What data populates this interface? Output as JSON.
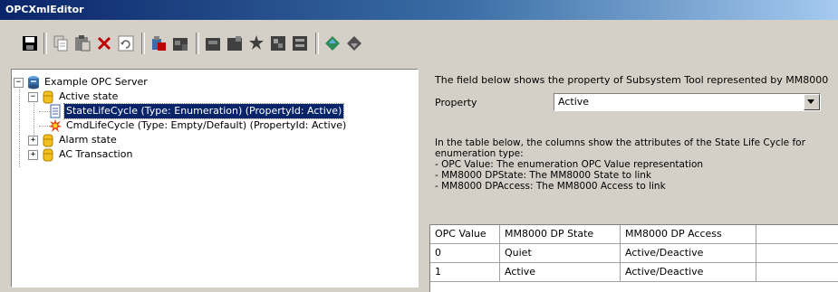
{
  "window": {
    "title": "OPCXmlEditor"
  },
  "toolbar": {
    "buttons": [
      {
        "icon": "save-icon"
      },
      {
        "icon": "copy-icon"
      },
      {
        "icon": "paste-icon"
      },
      {
        "icon": "delete-icon"
      },
      {
        "icon": "undo-icon"
      },
      {
        "icon": "add-server-icon"
      },
      {
        "icon": "add-folder-icon"
      },
      {
        "icon": "add-item-icon"
      },
      {
        "icon": "add-property-icon"
      },
      {
        "icon": "add-star-icon"
      },
      {
        "icon": "add-enum-icon"
      },
      {
        "icon": "add-list-icon"
      },
      {
        "icon": "move-up-icon"
      },
      {
        "icon": "move-down-icon"
      }
    ]
  },
  "tree": {
    "root": "Example OPC Server",
    "active_state": "Active state",
    "state_life_cycle": "StateLifeCycle (Type: Enumeration) (PropertyId: Active)",
    "cmd_life_cycle": "CmdLifeCycle (Type: Empty/Default) (PropertyId: Active)",
    "alarm_state": "Alarm state",
    "ac_transaction": "AC Transaction"
  },
  "details": {
    "intro": "The field below shows the property of Subsystem Tool represented by MM8000",
    "property_label": "Property",
    "property_value": "Active",
    "table_desc_lines": [
      "In the table below, the columns show the attributes of the State Life Cycle for",
      "enumeration type:",
      "- OPC Value: The enumeration OPC Value representation",
      "- MM8000 DPState: The MM8000 State to link",
      "- MM8000 DPAccess: The MM8000 Access to link"
    ]
  },
  "table": {
    "headers": [
      "OPC Value",
      "MM8000 DP State",
      "MM8000 DP Access"
    ],
    "rows": [
      [
        "0",
        "Quiet",
        "Active/Deactive"
      ],
      [
        "1",
        "Active",
        "Active/Deactive"
      ]
    ]
  },
  "colors": {
    "selection": "#0a246a",
    "face": "#d4d0c8",
    "title_start": "#0a246a",
    "title_end": "#a6caf0"
  }
}
